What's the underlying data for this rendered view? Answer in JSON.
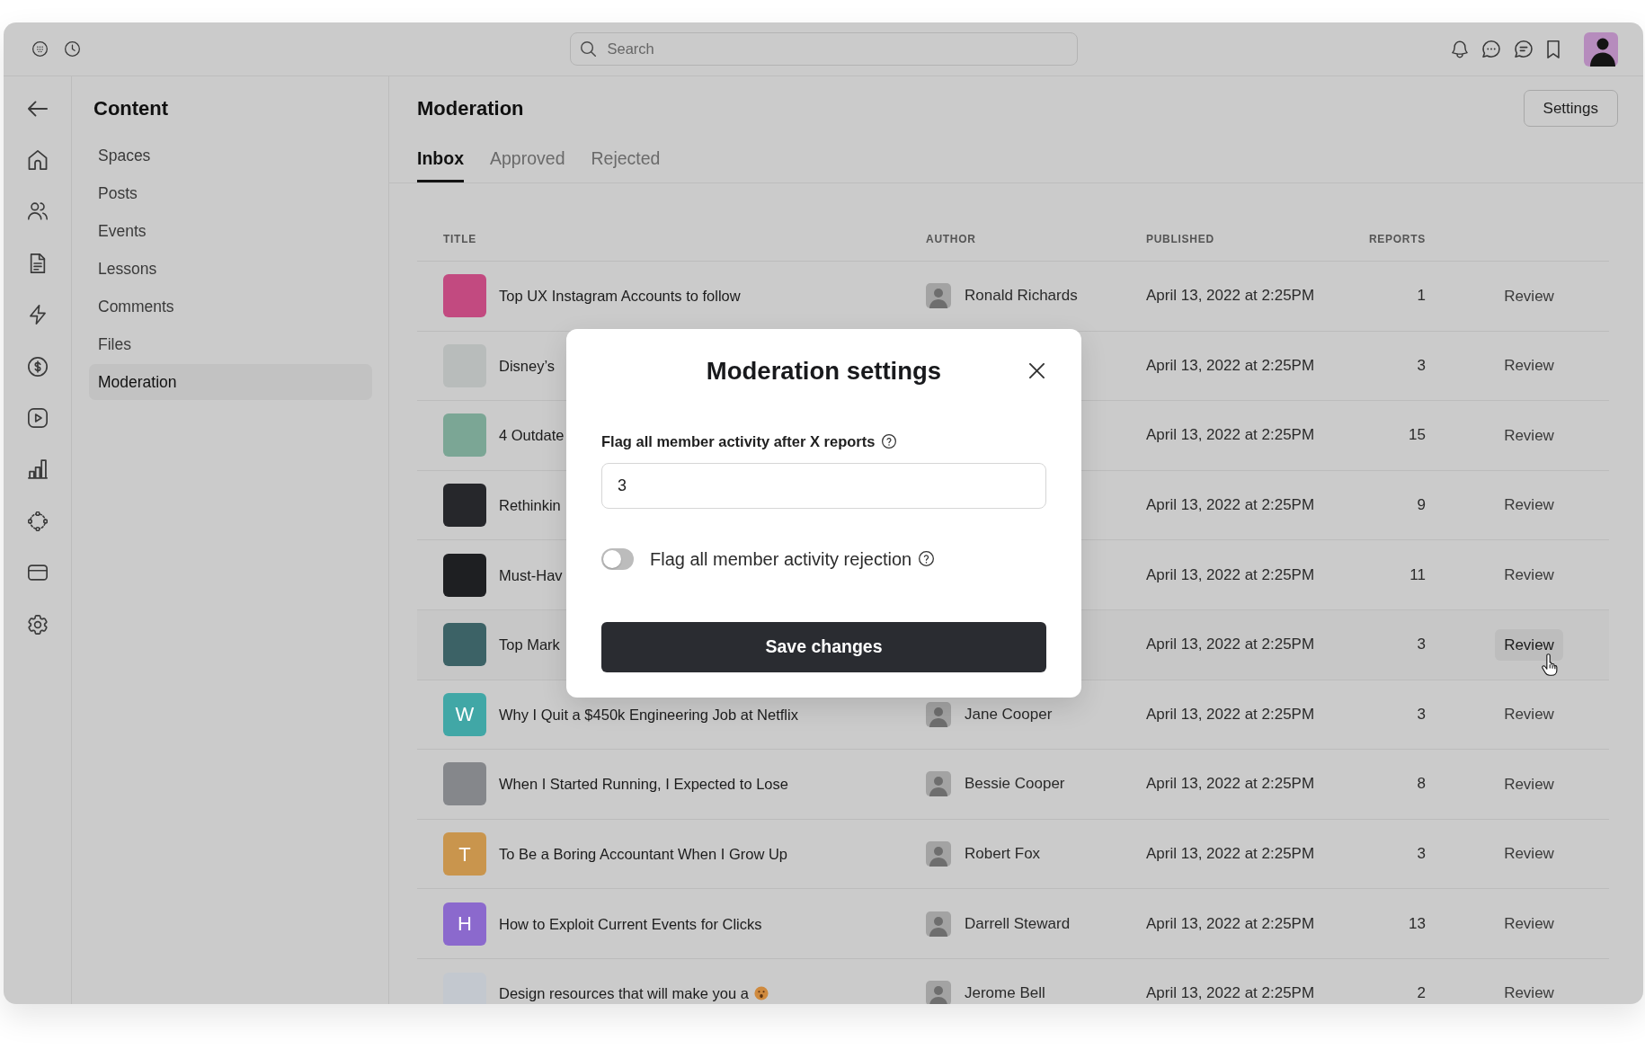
{
  "top_bar": {
    "search": {
      "placeholder": "Search"
    }
  },
  "sidebar": {
    "title": "Content",
    "items": [
      {
        "label": "Spaces",
        "selected": false
      },
      {
        "label": "Posts",
        "selected": false
      },
      {
        "label": "Events",
        "selected": false
      },
      {
        "label": "Lessons",
        "selected": false
      },
      {
        "label": "Comments",
        "selected": false
      },
      {
        "label": "Files",
        "selected": false
      },
      {
        "label": "Moderation",
        "selected": true
      }
    ]
  },
  "main": {
    "title": "Moderation",
    "settings_button": "Settings",
    "tabs": [
      {
        "label": "Inbox",
        "selected": true
      },
      {
        "label": "Approved",
        "selected": false
      },
      {
        "label": "Rejected",
        "selected": false
      }
    ]
  },
  "table": {
    "columns": [
      "TITLE",
      "AUTHOR",
      "PUBLISHED",
      "REPORTS"
    ],
    "rows": [
      {
        "thumbnail": {
          "kind": "photo",
          "color": "#c24a80"
        },
        "title": "Top UX Instagram Accounts to follow",
        "author": "Ronald Richards",
        "published": "April 13, 2022 at 2:25PM",
        "reports": "1",
        "action": "Review",
        "hovered": false
      },
      {
        "thumbnail": {
          "kind": "photo",
          "color": "#b8bcbb"
        },
        "title": "Disney’s",
        "published": "April 13, 2022 at 2:25PM",
        "reports": "3",
        "action": "Review",
        "hovered": false
      },
      {
        "thumbnail": {
          "kind": "photo",
          "color": "#7ba695"
        },
        "title": "4 Outdate",
        "published": "April 13, 2022 at 2:25PM",
        "reports": "15",
        "action": "Review",
        "hovered": false
      },
      {
        "thumbnail": {
          "kind": "photo",
          "color": "#26272b"
        },
        "title": "Rethinkin",
        "published": "April 13, 2022 at 2:25PM",
        "reports": "9",
        "action": "Review",
        "hovered": false
      },
      {
        "thumbnail": {
          "kind": "photo",
          "color": "#1e1f22"
        },
        "title": "Must-Hav",
        "published": "April 13, 2022 at 2:25PM",
        "reports": "11",
        "action": "Review",
        "hovered": false
      },
      {
        "thumbnail": {
          "kind": "photo",
          "color": "#3c6266"
        },
        "title": "Top Mark",
        "published": "April 13, 2022 at 2:25PM",
        "reports": "3",
        "action": "Review",
        "hovered": true
      },
      {
        "thumbnail": {
          "kind": "letter",
          "letter": "W",
          "color": "#41a7a6"
        },
        "title": "Why I Quit a $450k Engineering Job at Netflix",
        "author": "Jane Cooper",
        "published": "April 13, 2022 at 2:25PM",
        "reports": "3",
        "action": "Review",
        "hovered": false
      },
      {
        "thumbnail": {
          "kind": "photo",
          "color": "#85878b"
        },
        "title": "When I Started Running, I Expected to Lose",
        "author": "Bessie Cooper",
        "published": "April 13, 2022 at 2:25PM",
        "reports": "8",
        "action": "Review",
        "hovered": false
      },
      {
        "thumbnail": {
          "kind": "letter",
          "letter": "T",
          "color": "#c9954d"
        },
        "title": "To Be a Boring Accountant When I Grow Up",
        "author": "Robert Fox",
        "published": "April 13, 2022 at 2:25PM",
        "reports": "3",
        "action": "Review",
        "hovered": false
      },
      {
        "thumbnail": {
          "kind": "letter",
          "letter": "H",
          "color": "#8b69cd"
        },
        "title": "How to Exploit Current Events for Clicks",
        "author": "Darrell Steward",
        "published": "April 13, 2022 at 2:25PM",
        "reports": "13",
        "action": "Review",
        "hovered": false
      },
      {
        "thumbnail": {
          "kind": "photo",
          "color": "#c3c8cf"
        },
        "title": "Design resources that will make you a",
        "trailing_emoji": true,
        "author": "Jerome Bell",
        "published": "April 13, 2022 at 2:25PM",
        "reports": "2",
        "action": "Review",
        "hovered": false
      }
    ]
  },
  "modal": {
    "title": "Moderation settings",
    "reports_field": {
      "label": "Flag all member activity after X reports",
      "value": "3"
    },
    "rejection_toggle": {
      "label": "Flag all member activity rejection",
      "on": false
    },
    "save_button": "Save changes"
  }
}
